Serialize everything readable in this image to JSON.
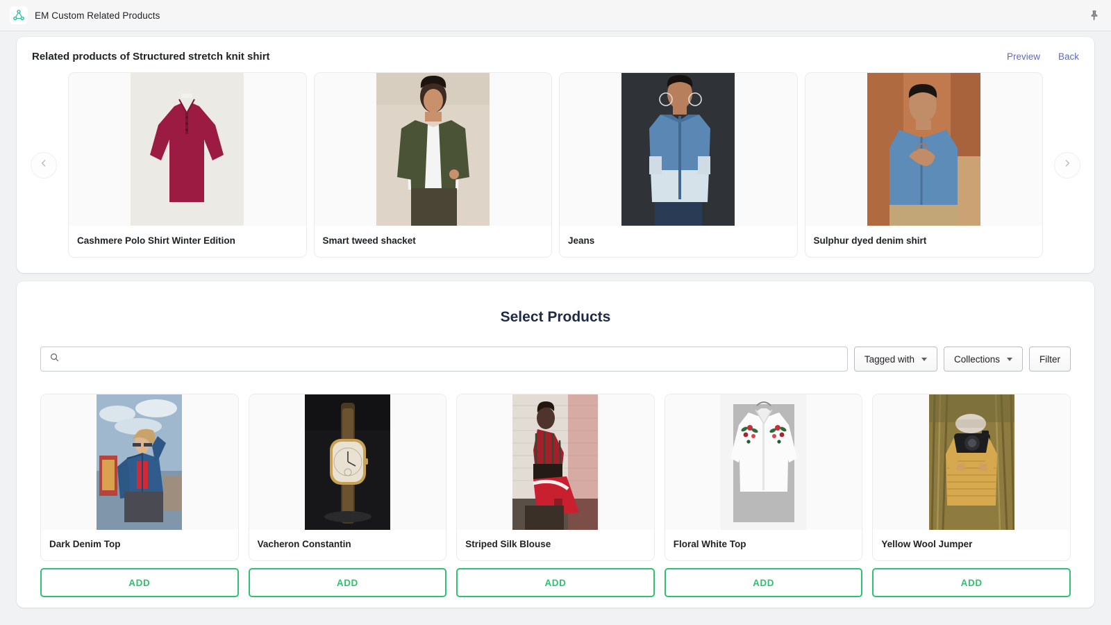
{
  "appbar": {
    "title": "EM Custom Related Products",
    "app_icon": "network-nodes-icon",
    "pin_icon": "pin-icon",
    "icon_color": "#2bbfa6"
  },
  "related": {
    "title": "Related products of Structured stretch knit shirt",
    "preview_label": "Preview",
    "back_label": "Back",
    "prev_icon": "chevron-left-icon",
    "next_icon": "chevron-right-icon",
    "link_color": "#5c6ac4",
    "items": [
      {
        "name": "Cashmere Polo Shirt Winter Edition",
        "image": "maroon-cashmere-polo-shirt"
      },
      {
        "name": "Smart tweed shacket",
        "image": "man-in-olive-tweed-shacket"
      },
      {
        "name": "Jeans",
        "image": "man-in-two-tone-denim-shirt"
      },
      {
        "name": "Sulphur dyed denim shirt",
        "image": "man-seated-in-blue-denim-shirt"
      }
    ]
  },
  "select": {
    "title": "Select Products",
    "search": {
      "value": "",
      "placeholder": "",
      "icon": "search-icon"
    },
    "filters": [
      {
        "label": "Tagged with",
        "icon": "chevron-down-icon"
      },
      {
        "label": "Collections",
        "icon": "chevron-down-icon"
      }
    ],
    "filter_button": "Filter",
    "add_label": "ADD",
    "add_color": "#2ec26e",
    "products": [
      {
        "name": "Dark Denim Top",
        "image": "woman-in-denim-jacket-outdoors"
      },
      {
        "name": "Vacheron Constantin",
        "image": "gold-wristwatch-on-dark-background"
      },
      {
        "name": "Striped Silk Blouse",
        "image": "woman-in-red-striped-outfit-brick-wall"
      },
      {
        "name": "Floral White Top",
        "image": "white-shirt-with-floral-embroidery"
      },
      {
        "name": "Yellow Wool Jumper",
        "image": "woman-with-camera-in-cornfield"
      }
    ]
  }
}
